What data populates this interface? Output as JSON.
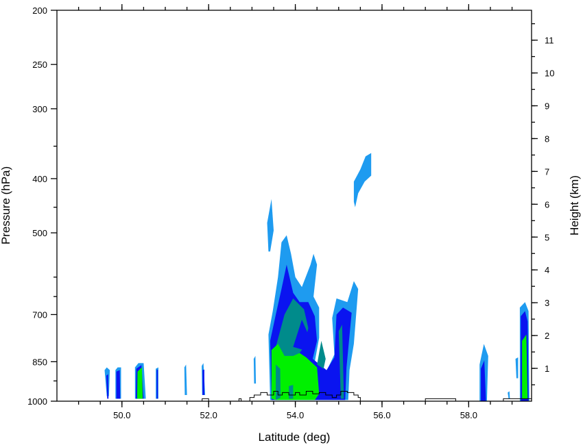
{
  "chart_data": {
    "type": "heatmap",
    "title": "",
    "xlabel": "Latitude (deg)",
    "ylabel": "Pressure (hPa)",
    "y2label": "Height (km)",
    "xlim": [
      48.5,
      59.45
    ],
    "ylim_pressure": [
      1000,
      200
    ],
    "y_scale": "log",
    "x_ticks": [
      {
        "value": 50.0,
        "label": "50.0"
      },
      {
        "value": 52.0,
        "label": "52.0"
      },
      {
        "value": 54.0,
        "label": "54.0"
      },
      {
        "value": 56.0,
        "label": "56.0"
      },
      {
        "value": 58.0,
        "label": "58.0"
      }
    ],
    "x_minor_step": 0.5,
    "y_ticks": [
      {
        "value": 200,
        "label": "200"
      },
      {
        "value": 250,
        "label": "250"
      },
      {
        "value": 300,
        "label": "300"
      },
      {
        "value": 400,
        "label": "400"
      },
      {
        "value": 500,
        "label": "500"
      },
      {
        "value": 700,
        "label": "700"
      },
      {
        "value": 850,
        "label": "850"
      },
      {
        "value": 1000,
        "label": "1000"
      }
    ],
    "y_minor_ticks": [
      920,
      650,
      600,
      450,
      350
    ],
    "y2_ticks": [
      {
        "value": 1,
        "label": "1"
      },
      {
        "value": 2,
        "label": "2"
      },
      {
        "value": 3,
        "label": "3"
      },
      {
        "value": 4,
        "label": "4"
      },
      {
        "value": 5,
        "label": "5"
      },
      {
        "value": 6,
        "label": "6"
      },
      {
        "value": 7,
        "label": "7"
      },
      {
        "value": 8,
        "label": "8"
      },
      {
        "value": 9,
        "label": "9"
      },
      {
        "value": 10,
        "label": "10"
      },
      {
        "value": 11,
        "label": "11"
      }
    ],
    "grid": false,
    "legend": "none",
    "level_colors": [
      "#1e9bf0",
      "#0a14f0",
      "#008b8b",
      "#00f000"
    ],
    "outline_color": "#000000",
    "regions": [
      {
        "level": 0,
        "polygon": [
          [
            49.65,
            980
          ],
          [
            49.6,
            880
          ],
          [
            49.65,
            870
          ],
          [
            49.72,
            880
          ],
          [
            49.7,
            980
          ]
        ]
      },
      {
        "level": 1,
        "polygon": [
          [
            49.66,
            990
          ],
          [
            49.64,
            900
          ],
          [
            49.68,
            895
          ],
          [
            49.69,
            990
          ]
        ]
      },
      {
        "level": 0,
        "polygon": [
          [
            49.85,
            990
          ],
          [
            49.85,
            880
          ],
          [
            49.9,
            870
          ],
          [
            49.98,
            870
          ],
          [
            49.98,
            990
          ]
        ]
      },
      {
        "level": 1,
        "polygon": [
          [
            49.87,
            990
          ],
          [
            49.87,
            885
          ],
          [
            49.95,
            880
          ],
          [
            49.96,
            990
          ]
        ]
      },
      {
        "level": 0,
        "polygon": [
          [
            50.3,
            990
          ],
          [
            50.3,
            870
          ],
          [
            50.38,
            855
          ],
          [
            50.5,
            855
          ],
          [
            50.55,
            990
          ]
        ]
      },
      {
        "level": 1,
        "polygon": [
          [
            50.32,
            990
          ],
          [
            50.33,
            875
          ],
          [
            50.45,
            862
          ],
          [
            50.5,
            990
          ]
        ]
      },
      {
        "level": 3,
        "polygon": [
          [
            50.35,
            990
          ],
          [
            50.36,
            885
          ],
          [
            50.46,
            870
          ],
          [
            50.48,
            990
          ]
        ]
      },
      {
        "level": 0,
        "polygon": [
          [
            50.78,
            990
          ],
          [
            50.78,
            875
          ],
          [
            50.84,
            870
          ],
          [
            50.84,
            990
          ]
        ]
      },
      {
        "level": 1,
        "polygon": [
          [
            50.8,
            990
          ],
          [
            50.8,
            880
          ],
          [
            50.83,
            878
          ],
          [
            50.83,
            990
          ]
        ]
      },
      {
        "level": 0,
        "polygon": [
          [
            51.45,
            975
          ],
          [
            51.44,
            870
          ],
          [
            51.48,
            860
          ],
          [
            51.5,
            975
          ]
        ]
      },
      {
        "level": 0,
        "polygon": [
          [
            51.85,
            975
          ],
          [
            51.84,
            865
          ],
          [
            51.88,
            855
          ],
          [
            51.92,
            975
          ]
        ]
      },
      {
        "level": 1,
        "polygon": [
          [
            51.86,
            975
          ],
          [
            51.86,
            880
          ],
          [
            51.9,
            878
          ],
          [
            51.9,
            975
          ]
        ]
      },
      {
        "level": 0,
        "polygon": [
          [
            53.05,
            930
          ],
          [
            53.04,
            840
          ],
          [
            53.08,
            830
          ],
          [
            53.09,
            930
          ]
        ]
      },
      {
        "level": 0,
        "polygon": [
          [
            53.38,
            540
          ],
          [
            53.35,
            480
          ],
          [
            53.45,
            435
          ],
          [
            53.5,
            495
          ],
          [
            53.42,
            540
          ]
        ]
      },
      {
        "level": 0,
        "polygon": [
          [
            53.42,
            995
          ],
          [
            53.38,
            760
          ],
          [
            53.48,
            690
          ],
          [
            53.6,
            600
          ],
          [
            53.68,
            520
          ],
          [
            53.8,
            505
          ],
          [
            53.9,
            545
          ],
          [
            54.0,
            600
          ],
          [
            54.15,
            625
          ],
          [
            54.35,
            570
          ],
          [
            54.42,
            545
          ],
          [
            54.5,
            570
          ],
          [
            54.42,
            650
          ],
          [
            54.55,
            680
          ],
          [
            54.55,
            770
          ],
          [
            54.45,
            850
          ],
          [
            54.7,
            890
          ],
          [
            54.9,
            825
          ],
          [
            54.85,
            710
          ],
          [
            54.95,
            655
          ],
          [
            55.2,
            665
          ],
          [
            55.35,
            610
          ],
          [
            55.45,
            630
          ],
          [
            55.35,
            790
          ],
          [
            55.25,
            880
          ],
          [
            55.22,
            995
          ]
        ]
      },
      {
        "level": 1,
        "polygon": [
          [
            53.45,
            995
          ],
          [
            53.42,
            780
          ],
          [
            53.55,
            700
          ],
          [
            53.68,
            630
          ],
          [
            53.8,
            570
          ],
          [
            53.95,
            640
          ],
          [
            54.1,
            665
          ],
          [
            54.3,
            665
          ],
          [
            54.45,
            705
          ],
          [
            54.5,
            780
          ],
          [
            54.4,
            840
          ],
          [
            54.72,
            880
          ],
          [
            54.9,
            835
          ],
          [
            54.95,
            700
          ],
          [
            55.1,
            680
          ],
          [
            55.3,
            695
          ],
          [
            55.18,
            870
          ],
          [
            55.15,
            995
          ]
        ]
      },
      {
        "level": 2,
        "polygon": [
          [
            53.55,
            930
          ],
          [
            53.55,
            800
          ],
          [
            53.75,
            700
          ],
          [
            53.95,
            655
          ],
          [
            54.2,
            685
          ],
          [
            54.3,
            740
          ],
          [
            54.2,
            800
          ],
          [
            54.05,
            830
          ],
          [
            53.95,
            880
          ],
          [
            53.75,
            960
          ]
        ]
      },
      {
        "level": 1,
        "polygon": [
          [
            53.95,
            800
          ],
          [
            54.15,
            715
          ],
          [
            54.3,
            760
          ],
          [
            54.2,
            810
          ]
        ]
      },
      {
        "level": 2,
        "polygon": [
          [
            54.5,
            860
          ],
          [
            54.6,
            780
          ],
          [
            54.7,
            840
          ],
          [
            54.65,
            875
          ]
        ]
      },
      {
        "level": 2,
        "polygon": [
          [
            55.05,
            990
          ],
          [
            55.0,
            750
          ],
          [
            55.08,
            730
          ],
          [
            55.12,
            990
          ]
        ]
      },
      {
        "level": 3,
        "polygon": [
          [
            53.45,
            990
          ],
          [
            53.45,
            810
          ],
          [
            53.6,
            790
          ],
          [
            53.75,
            830
          ],
          [
            53.95,
            830
          ],
          [
            54.1,
            820
          ],
          [
            54.25,
            835
          ],
          [
            54.5,
            870
          ],
          [
            54.55,
            970
          ],
          [
            54.45,
            995
          ],
          [
            53.55,
            995
          ]
        ]
      },
      {
        "level": 2,
        "polygon": [
          [
            53.55,
            995
          ],
          [
            53.55,
            860
          ],
          [
            53.65,
            875
          ],
          [
            53.66,
            985
          ]
        ]
      },
      {
        "level": 2,
        "polygon": [
          [
            53.85,
            990
          ],
          [
            53.85,
            940
          ],
          [
            53.95,
            935
          ],
          [
            53.95,
            990
          ]
        ]
      },
      {
        "level": 0,
        "polygon": [
          [
            55.35,
            440
          ],
          [
            55.35,
            405
          ],
          [
            55.5,
            385
          ],
          [
            55.62,
            365
          ],
          [
            55.75,
            360
          ],
          [
            55.75,
            395
          ],
          [
            55.6,
            405
          ],
          [
            55.45,
            425
          ],
          [
            55.38,
            450
          ]
        ]
      },
      {
        "level": 0,
        "polygon": [
          [
            58.25,
            1000
          ],
          [
            58.25,
            860
          ],
          [
            58.35,
            790
          ],
          [
            58.45,
            830
          ],
          [
            58.42,
            1000
          ]
        ]
      },
      {
        "level": 1,
        "polygon": [
          [
            58.28,
            1000
          ],
          [
            58.28,
            875
          ],
          [
            58.36,
            845
          ],
          [
            58.4,
            1000
          ]
        ]
      },
      {
        "level": 0,
        "polygon": [
          [
            59.1,
            910
          ],
          [
            59.08,
            840
          ],
          [
            59.14,
            835
          ],
          [
            59.14,
            910
          ]
        ]
      },
      {
        "level": 0,
        "polygon": [
          [
            58.92,
            990
          ],
          [
            58.9,
            965
          ],
          [
            58.94,
            960
          ],
          [
            58.95,
            990
          ]
        ]
      },
      {
        "level": 0,
        "polygon": [
          [
            59.18,
            1000
          ],
          [
            59.18,
            680
          ],
          [
            59.3,
            665
          ],
          [
            59.38,
            690
          ],
          [
            59.4,
            1000
          ]
        ]
      },
      {
        "level": 1,
        "polygon": [
          [
            59.2,
            1000
          ],
          [
            59.2,
            705
          ],
          [
            59.3,
            690
          ],
          [
            59.36,
            720
          ],
          [
            59.38,
            1000
          ]
        ]
      },
      {
        "level": 3,
        "polygon": [
          [
            59.23,
            990
          ],
          [
            59.23,
            780
          ],
          [
            59.33,
            760
          ],
          [
            59.36,
            990
          ]
        ]
      }
    ],
    "terrain_outline": [
      [
        51.85,
        1000
      ],
      [
        51.85,
        990
      ],
      [
        52.0,
        990
      ],
      [
        52.0,
        1000
      ],
      [
        52.7,
        1000
      ],
      [
        52.7,
        990
      ],
      [
        52.75,
        990
      ],
      [
        52.75,
        1000
      ],
      [
        52.95,
        1000
      ],
      [
        52.95,
        985
      ],
      [
        53.05,
        985
      ],
      [
        53.05,
        975
      ],
      [
        53.2,
        975
      ],
      [
        53.2,
        965
      ],
      [
        53.35,
        965
      ],
      [
        53.35,
        975
      ],
      [
        53.5,
        975
      ],
      [
        53.5,
        960
      ],
      [
        53.6,
        960
      ],
      [
        53.6,
        975
      ],
      [
        53.7,
        975
      ],
      [
        53.7,
        965
      ],
      [
        53.85,
        965
      ],
      [
        53.85,
        975
      ],
      [
        54.0,
        975
      ],
      [
        54.0,
        965
      ],
      [
        54.1,
        965
      ],
      [
        54.1,
        975
      ],
      [
        54.25,
        975
      ],
      [
        54.25,
        960
      ],
      [
        54.4,
        960
      ],
      [
        54.4,
        970
      ],
      [
        54.55,
        970
      ],
      [
        54.55,
        965
      ],
      [
        54.7,
        965
      ],
      [
        54.7,
        975
      ],
      [
        54.85,
        975
      ],
      [
        54.85,
        985
      ],
      [
        54.95,
        985
      ],
      [
        54.95,
        975
      ],
      [
        55.05,
        975
      ],
      [
        55.05,
        960
      ],
      [
        55.2,
        960
      ],
      [
        55.2,
        965
      ],
      [
        55.35,
        965
      ],
      [
        55.35,
        975
      ],
      [
        55.45,
        975
      ],
      [
        55.45,
        985
      ],
      [
        55.5,
        985
      ],
      [
        55.5,
        1000
      ],
      [
        57.0,
        1000
      ],
      [
        57.0,
        990
      ],
      [
        57.7,
        990
      ],
      [
        57.7,
        1000
      ],
      [
        58.8,
        1000
      ],
      [
        58.8,
        990
      ],
      [
        59.45,
        990
      ],
      [
        59.45,
        1000
      ]
    ]
  }
}
